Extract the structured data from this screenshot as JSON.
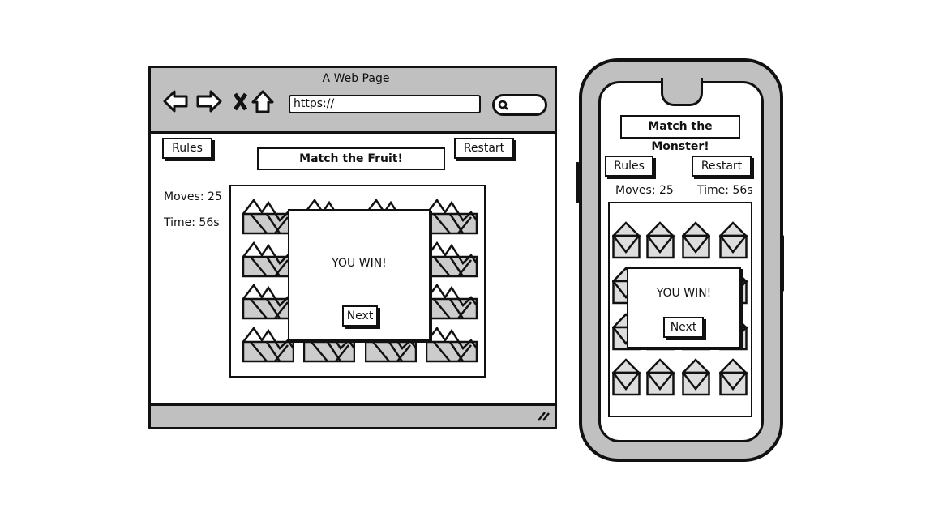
{
  "browser": {
    "title": "A Web Page",
    "url": "https://",
    "game": {
      "title": "Match the Fruit!",
      "rules_label": "Rules",
      "restart_label": "Restart",
      "moves": "Moves: 25",
      "time": "Time: 56s",
      "modal": {
        "message": "YOU WIN!",
        "next_label": "Next"
      }
    }
  },
  "phone": {
    "game": {
      "title": "Match the Monster!",
      "rules_label": "Rules",
      "restart_label": "Restart",
      "moves": "Moves: 25",
      "time": "Time: 56s",
      "modal": {
        "message": "YOU WIN!",
        "next_label": "Next"
      }
    }
  },
  "colors": {
    "chrome": "#c0c0c0",
    "card_fill": "#cccccc",
    "ink": "#111111"
  }
}
